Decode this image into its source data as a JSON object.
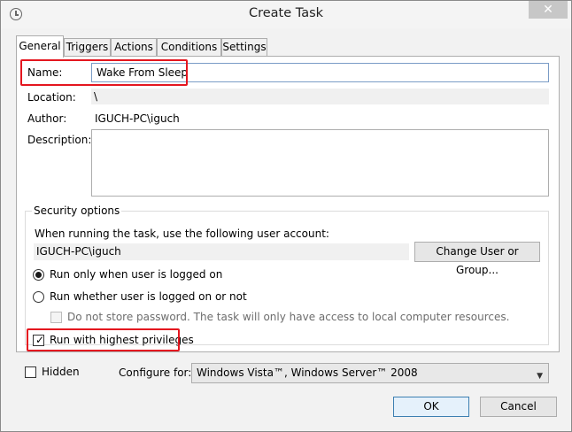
{
  "window": {
    "title": "Create Task",
    "close_glyph": "✕"
  },
  "tabs": [
    {
      "label": "General"
    },
    {
      "label": "Triggers"
    },
    {
      "label": "Actions"
    },
    {
      "label": "Conditions"
    },
    {
      "label": "Settings"
    }
  ],
  "general": {
    "name_label": "Name:",
    "name_value": "Wake From Sleep",
    "location_label": "Location:",
    "location_value": "\\",
    "author_label": "Author:",
    "author_value": "IGUCH-PC\\iguch",
    "description_label": "Description:",
    "description_value": ""
  },
  "security": {
    "title": "Security options",
    "account_prompt": "When running the task, use the following user account:",
    "account_value": "IGUCH-PC\\iguch",
    "change_button": "Change User or Group...",
    "radio_logged_on": "Run only when user is logged on",
    "radio_whether": "Run whether user is logged on or not",
    "no_store_password": "Do not store password.  The task will only have access to local computer resources.",
    "highest_privileges": "Run with highest privileges"
  },
  "footer": {
    "hidden_label": "Hidden",
    "configure_label": "Configure for:",
    "configure_value": "Windows Vista™, Windows Server™ 2008",
    "ok_button": "OK",
    "cancel_button": "Cancel"
  },
  "colors": {
    "highlight": "#e4161f",
    "focus_border": "#7a9cc6"
  }
}
